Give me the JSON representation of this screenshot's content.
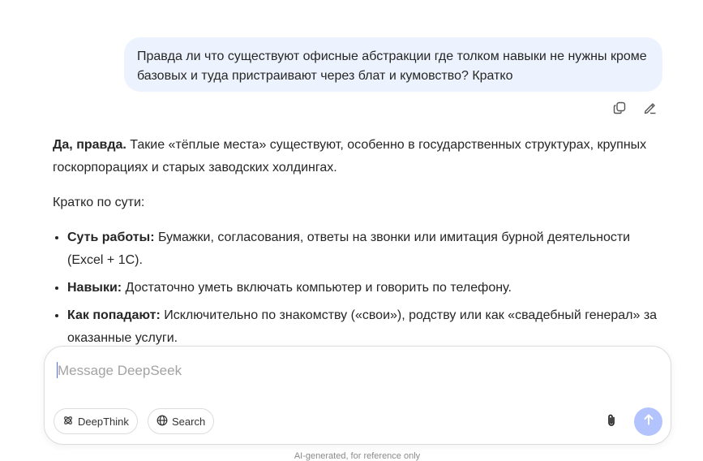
{
  "user_message": {
    "text": "Правда ли что существуют офисные абстракции где толком навыки не нужны кроме базовых и туда пристраивают через блат и кумовство? Кратко"
  },
  "message_actions": {
    "copy_icon": "copy-icon",
    "edit_icon": "edit-pencil-icon"
  },
  "answer": {
    "intro_bold": "Да, правда.",
    "intro_text": " Такие «тёплые места» существуют, особенно в государственных структурах, крупных госкорпорациях и старых заводских холдингах.",
    "summary_heading": "Кратко по сути:",
    "bullets": [
      {
        "label": "Суть работы:",
        "text": " Бумажки, согласования, ответы на звонки или имитация бурной деятельности (Excel + 1С)."
      },
      {
        "label": "Навыки:",
        "text": " Достаточно уметь включать компьютер и говорить по телефону."
      },
      {
        "label": "Как попадают:",
        "text": " Исключительно по знакомству («свои»), родству или как «свадебный генерал» за оказанные услуги."
      }
    ]
  },
  "composer": {
    "placeholder": "Message DeepSeek",
    "deepthink_label": "DeepThink",
    "search_label": "Search",
    "attach_icon": "paperclip-icon",
    "send_icon": "arrow-up-icon"
  },
  "disclaimer": "AI-generated, for reference only",
  "colors": {
    "accent": "#4d6bfe",
    "send_disabled": "#b3c3fd",
    "user_bubble": "#edf3fe"
  }
}
